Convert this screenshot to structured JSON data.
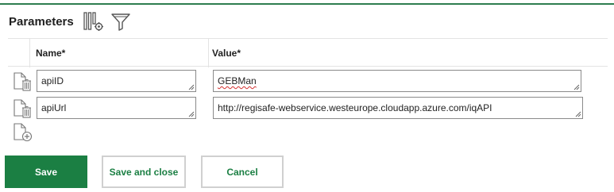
{
  "section": {
    "title": "Parameters",
    "icons": [
      "column-settings-icon",
      "filter-icon"
    ]
  },
  "table": {
    "columns": [
      "Name*",
      "Value*"
    ],
    "rows": [
      {
        "name": "apiID",
        "value": "GEBMan"
      },
      {
        "name": "apiUrl",
        "value": "http://regisafe-webservice.westeurope.cloudapp.azure.com/iqAPI"
      }
    ],
    "row_icon": "delete-row-icon",
    "add_icon": "add-row-icon"
  },
  "buttons": {
    "save": "Save",
    "save_and_close": "Save and close",
    "cancel": "Cancel"
  },
  "colors": {
    "accent": "#1b7f43",
    "top_rule": "#2e7d4f",
    "spellcheck": "#d32f2f"
  }
}
